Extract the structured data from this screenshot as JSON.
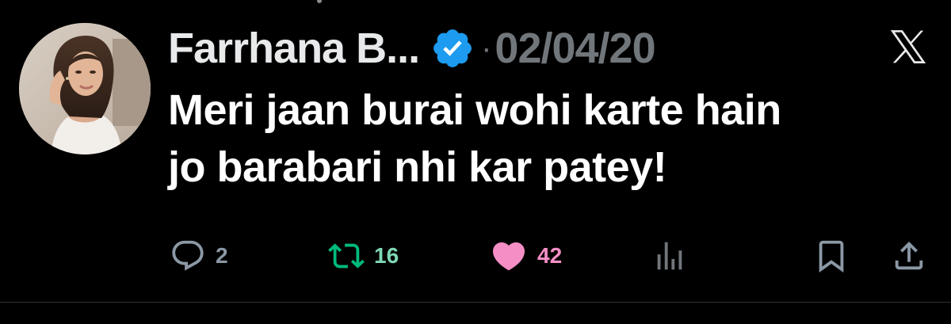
{
  "tweet": {
    "author_name": "Farrhana B...",
    "date": "02/04/20",
    "separator": "·",
    "text_lines": [
      "Meri jaan burai wohi karte hain",
      "jo barabari nhi kar patey!"
    ],
    "verified": true,
    "avatar_icon": "profile-photo"
  },
  "actions": {
    "reply": {
      "icon": "reply-bubble-icon",
      "count": "2"
    },
    "retweet": {
      "icon": "retweet-icon",
      "count": "16"
    },
    "like": {
      "icon": "heart-icon",
      "count": "42",
      "liked": true
    },
    "views": {
      "icon": "analytics-icon"
    },
    "bookmark": {
      "icon": "bookmark-icon"
    },
    "share": {
      "icon": "share-icon"
    }
  },
  "brand": {
    "logo": "x-logo-icon"
  },
  "colors": {
    "background": "#000000",
    "text_primary": "#ffffff",
    "text_secondary": "#71767b",
    "verified_blue": "#1d9bf0",
    "retweet_green": "#00ba7c",
    "like_pink": "#f91880"
  }
}
